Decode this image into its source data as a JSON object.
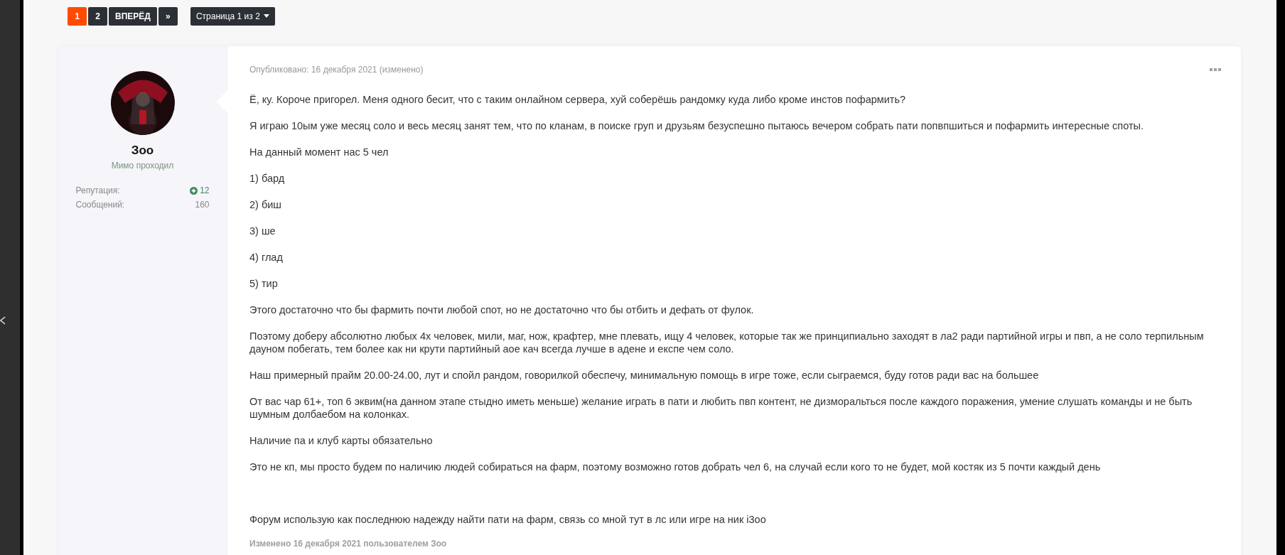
{
  "pagination": {
    "pages": [
      {
        "label": "1",
        "selected": true
      },
      {
        "label": "2",
        "selected": false
      }
    ],
    "next": "ВПЕРЁД",
    "last": "»",
    "jump": "Страница 1 из 2"
  },
  "post": {
    "author": {
      "name": "Зоо",
      "rank": "Мимо проходил",
      "stats": [
        {
          "label": "Репутация:",
          "value": "12",
          "kind": "reputation"
        },
        {
          "label": "Сообщений:",
          "value": "160",
          "kind": "plain"
        }
      ]
    },
    "meta": "Опубликовано: 16 декабря 2021 (изменено)",
    "paragraphs": [
      "Ё, ку. Короче пригорел. Меня одного бесит, что с таким онлайном сервера, хуй соберёшь рандомку куда либо кроме инстов пофармить?",
      "Я играю 10ым уже месяц соло и весь месяц занят тем, что по кланам, в поиске груп и друзьям безуспешно пытаюсь вечером собрать пати попвпшиться и пофармить интересные споты.",
      "На данный момент нас 5 чел",
      "1) бард",
      "2) биш",
      "3) ше",
      "4) глад",
      "5) тир",
      "Этого достаточно что бы фармить почти любой спот, но не достаточно что бы отбить и дефать от фулок.",
      "Поэтому доберу абсолютно любых 4х человек, мили, маг, нож, крафтер, мне плевать, ищу 4 человек, которые так же принципиально заходят в ла2 ради партийной игры и пвп, а не соло терпильным дауном побегать,  тем более как ни крути партийный аое кач всегда лучше в адене и експе чем соло.",
      "Наш примерный прайм 20.00-24.00, лут и спойл рандом, говорилкой обеспечу, минимальную помощь в игре тоже, если сыграемся, буду готов ради вас на большее",
      "От вас чар 61+, топ 6 эквим(на данном этапе стыдно иметь меньше) желание играть в пати и любить пвп контент, не дизморальться после каждого поражения, умение слушать команды и не быть шумным долбаебом на колонках.",
      "Наличие па и клуб карты обязательно",
      "Это не кп, мы просто будем по наличию людей собираться на фарм, поэтому возможно готов добрать чел 6, на случай если кого то не будет, мой костяк из 5 почти каждый день"
    ],
    "closing": "Форум использую как последнюю надежду найти пати на фарм, связь со мной тут в лс или игре на ник i3oo",
    "edited": "Изменено 16 декабря 2021 пользователем Зоо"
  }
}
